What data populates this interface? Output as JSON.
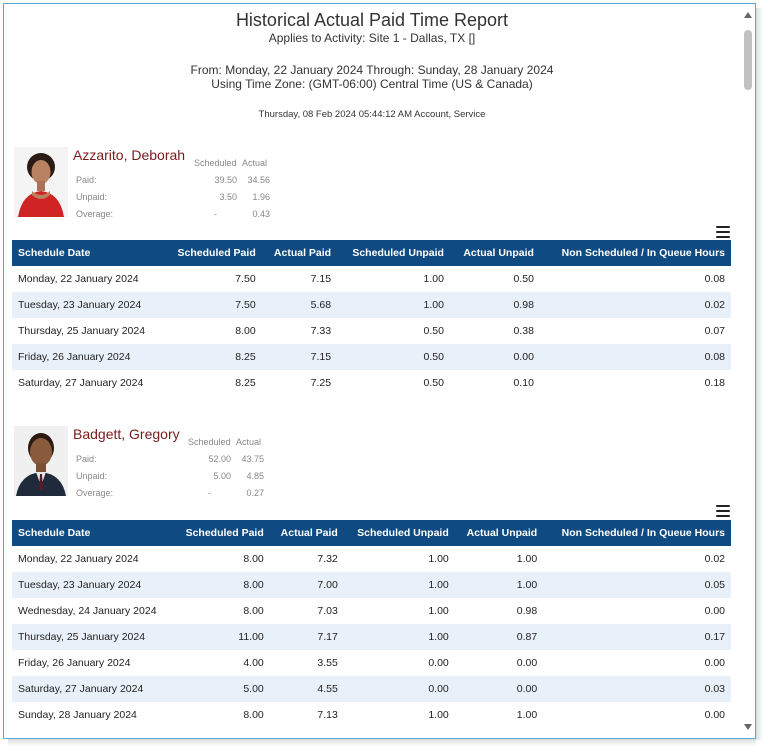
{
  "report": {
    "title": "Historical Actual Paid Time Report",
    "applies_to": "Applies to Activity: Site 1 - Dallas, TX []",
    "range": "From: Monday, 22 January 2024 Through: Sunday, 28 January 2024",
    "timezone": "Using Time Zone: (GMT-06:00) Central Time (US & Canada)",
    "generated": "Thursday, 08 Feb 2024 05:44:12 AM Account, Service"
  },
  "columns": [
    "Schedule Date",
    "Scheduled Paid",
    "Actual Paid",
    "Scheduled Unpaid",
    "Actual Unpaid",
    "Non Scheduled / In Queue Hours"
  ],
  "stat_labels": {
    "scheduled": "Scheduled",
    "actual": "Actual",
    "paid": "Paid:",
    "unpaid": "Unpaid:",
    "overage": "Overage:"
  },
  "employees": [
    {
      "name": "Azzarito, Deborah",
      "paid": [
        "39.50",
        "34.56"
      ],
      "unpaid": [
        "3.50",
        "1.96"
      ],
      "overage": [
        "-",
        "0.43"
      ],
      "rows": [
        [
          "Monday, 22 January 2024",
          "7.50",
          "7.15",
          "1.00",
          "0.50",
          "0.08"
        ],
        [
          "Tuesday, 23 January 2024",
          "7.50",
          "5.68",
          "1.00",
          "0.98",
          "0.02"
        ],
        [
          "Thursday, 25 January 2024",
          "8.00",
          "7.33",
          "0.50",
          "0.38",
          "0.07"
        ],
        [
          "Friday, 26 January 2024",
          "8.25",
          "7.15",
          "0.50",
          "0.00",
          "0.08"
        ],
        [
          "Saturday, 27 January 2024",
          "8.25",
          "7.25",
          "0.50",
          "0.10",
          "0.18"
        ]
      ]
    },
    {
      "name": "Badgett, Gregory",
      "paid": [
        "52.00",
        "43.75"
      ],
      "unpaid": [
        "5.00",
        "4.85"
      ],
      "overage": [
        "-",
        "0.27"
      ],
      "rows": [
        [
          "Monday, 22 January 2024",
          "8.00",
          "7.32",
          "1.00",
          "1.00",
          "0.02"
        ],
        [
          "Tuesday, 23 January 2024",
          "8.00",
          "7.00",
          "1.00",
          "1.00",
          "0.05"
        ],
        [
          "Wednesday, 24 January 2024",
          "8.00",
          "7.03",
          "1.00",
          "0.98",
          "0.00"
        ],
        [
          "Thursday, 25 January 2024",
          "11.00",
          "7.17",
          "1.00",
          "0.87",
          "0.17"
        ],
        [
          "Friday, 26 January 2024",
          "4.00",
          "3.55",
          "0.00",
          "0.00",
          "0.00"
        ],
        [
          "Saturday, 27 January 2024",
          "5.00",
          "4.55",
          "0.00",
          "0.00",
          "0.03"
        ],
        [
          "Sunday, 28 January 2024",
          "8.00",
          "7.13",
          "1.00",
          "1.00",
          "0.00"
        ]
      ]
    }
  ]
}
